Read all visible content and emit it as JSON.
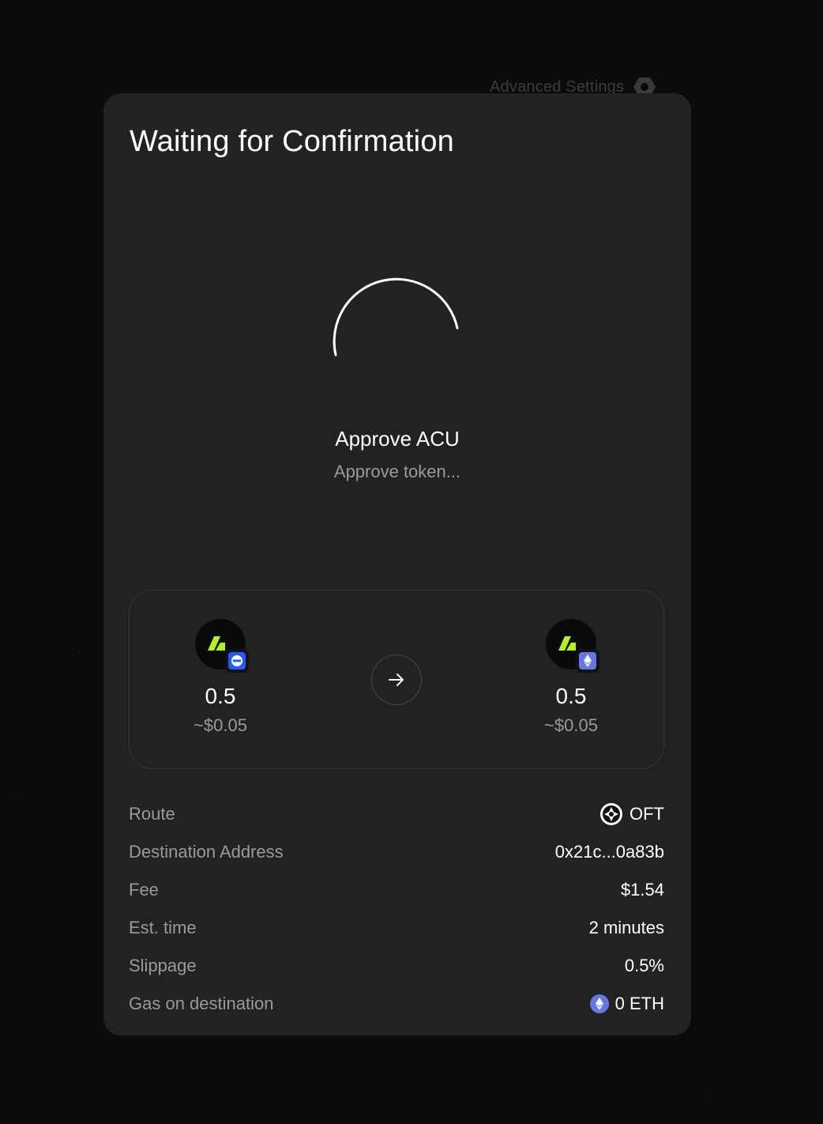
{
  "background": {
    "advanced_settings_label": "Advanced Settings",
    "settings_icon": "gear-icon"
  },
  "modal": {
    "title": "Waiting for Confirmation",
    "step": {
      "title": "Approve ACU",
      "subtitle": "Approve token..."
    },
    "swap": {
      "source": {
        "token_icon": "acu-token-icon",
        "chain_icon": "source-chain-icon",
        "amount": "0.5",
        "usd": "~$0.05"
      },
      "arrow_icon": "arrow-right-icon",
      "destination": {
        "token_icon": "acu-token-icon",
        "chain_icon": "ethereum-chain-icon",
        "amount": "0.5",
        "usd": "~$0.05"
      }
    },
    "details": [
      {
        "label": "Route",
        "value": "OFT",
        "icon": "oft-route-icon"
      },
      {
        "label": "Destination Address",
        "value": "0x21c...0a83b"
      },
      {
        "label": "Fee",
        "value": "$1.54"
      },
      {
        "label": "Est. time",
        "value": "2 minutes"
      },
      {
        "label": "Slippage",
        "value": "0.5%"
      },
      {
        "label": "Gas on destination",
        "value": "0 ETH",
        "icon": "eth-icon"
      }
    ]
  },
  "colors": {
    "modal_bg": "#222222",
    "accent_token": "#b6f21b",
    "source_chain": "#1f5bff",
    "eth_chain": "#6378e6"
  }
}
